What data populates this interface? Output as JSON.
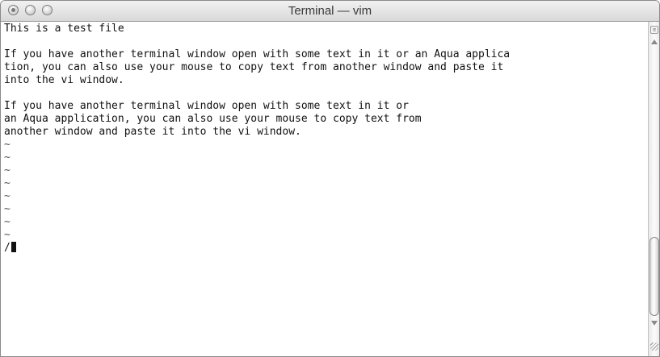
{
  "window": {
    "title": "Terminal — vim"
  },
  "editor": {
    "lines": [
      "This is a test file",
      "",
      "If you have another terminal window open with some text in it or an Aqua applica",
      "tion, you can also use your mouse to copy text from another window and paste it",
      "into the vi window.",
      "",
      "If you have another terminal window open with some text in it or",
      "an Aqua application, you can also use your mouse to copy text from",
      "another window and paste it into the vi window.",
      "~",
      "~",
      "~",
      "~",
      "~",
      "~",
      "~",
      "~"
    ],
    "command_line": "/"
  }
}
